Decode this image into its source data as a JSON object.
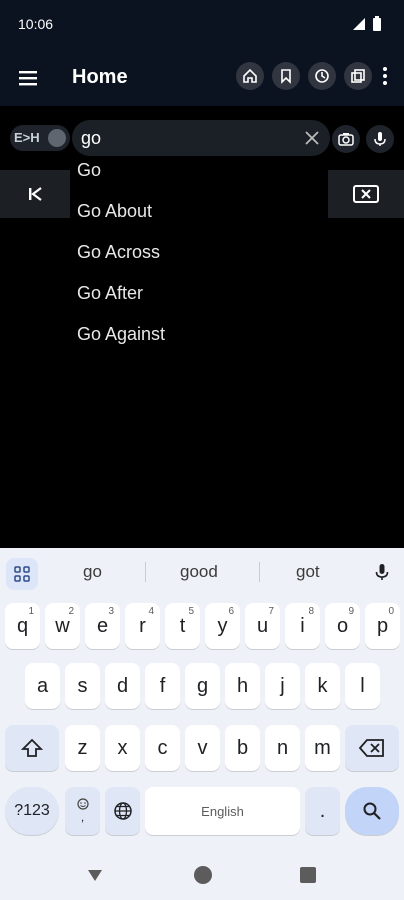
{
  "status": {
    "time": "10:06"
  },
  "appbar": {
    "title": "Home"
  },
  "search": {
    "toggle_label": "E>H",
    "query": "go"
  },
  "suggestions": [
    "Go",
    "Go About",
    "Go Across",
    "Go After",
    "Go Against"
  ],
  "keyboard": {
    "predictions": [
      "go",
      "good",
      "got"
    ],
    "row1": [
      {
        "label": "q",
        "hint": "1"
      },
      {
        "label": "w",
        "hint": "2"
      },
      {
        "label": "e",
        "hint": "3"
      },
      {
        "label": "r",
        "hint": "4"
      },
      {
        "label": "t",
        "hint": "5"
      },
      {
        "label": "y",
        "hint": "6"
      },
      {
        "label": "u",
        "hint": "7"
      },
      {
        "label": "i",
        "hint": "8"
      },
      {
        "label": "o",
        "hint": "9"
      },
      {
        "label": "p",
        "hint": "0"
      }
    ],
    "row2": [
      "a",
      "s",
      "d",
      "f",
      "g",
      "h",
      "j",
      "k",
      "l"
    ],
    "row3": [
      "z",
      "x",
      "c",
      "v",
      "b",
      "n",
      "m"
    ],
    "symbols": "?123",
    "comma": ",",
    "space": "English",
    "period": "."
  }
}
